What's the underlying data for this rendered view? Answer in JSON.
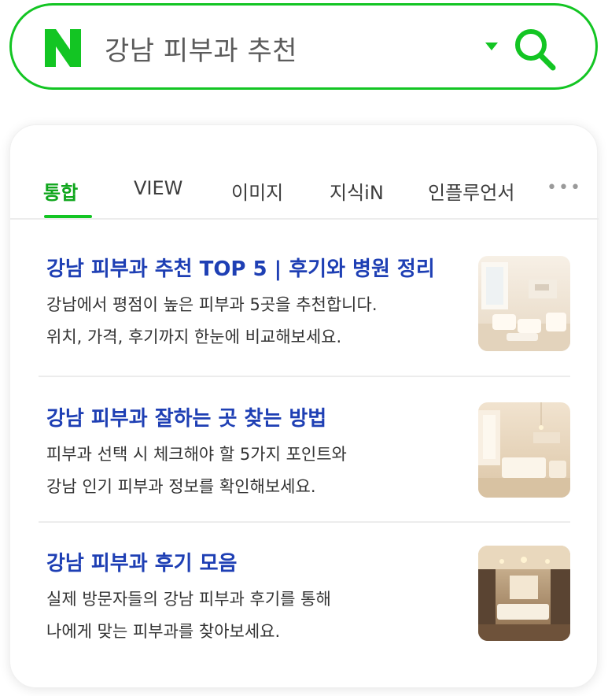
{
  "search": {
    "query": "강남 피부과 추천",
    "logo_letter": "N"
  },
  "tabs": [
    {
      "label": "통합",
      "active": true
    },
    {
      "label": "VIEW",
      "active": false
    },
    {
      "label": "이미지",
      "active": false
    },
    {
      "label": "지식iN",
      "active": false
    },
    {
      "label": "인플루언서",
      "active": false
    }
  ],
  "more_label": "•••",
  "results": [
    {
      "title": "강남 피부과 추천 TOP 5 | 후기와 병원 정리",
      "desc_line1": "강남에서 평점이 높은 피부과 5곳을 추천합니다.",
      "desc_line2": "위치, 가격, 후기까지 한눈에 비교해보세요.",
      "thumb_icon": "clinic-lounge-image"
    },
    {
      "title": "강남 피부과 잘하는 곳 찾는 방법",
      "desc_line1": "피부과 선택 시 체크해야 할 5가지 포인트와",
      "desc_line2": "강남 인기 피부과 정보를 확인해보세요.",
      "thumb_icon": "clinic-reception-image"
    },
    {
      "title": "강남 피부과 후기 모음",
      "desc_line1": "실제 방문자들의 강남 피부과 후기를 통해",
      "desc_line2": "나에게 맞는 피부과를 찾아보세요.",
      "thumb_icon": "clinic-treatment-room-image"
    }
  ],
  "colors": {
    "brand_green": "#13c523",
    "title_blue": "#1e3fb4",
    "text": "#333333"
  }
}
